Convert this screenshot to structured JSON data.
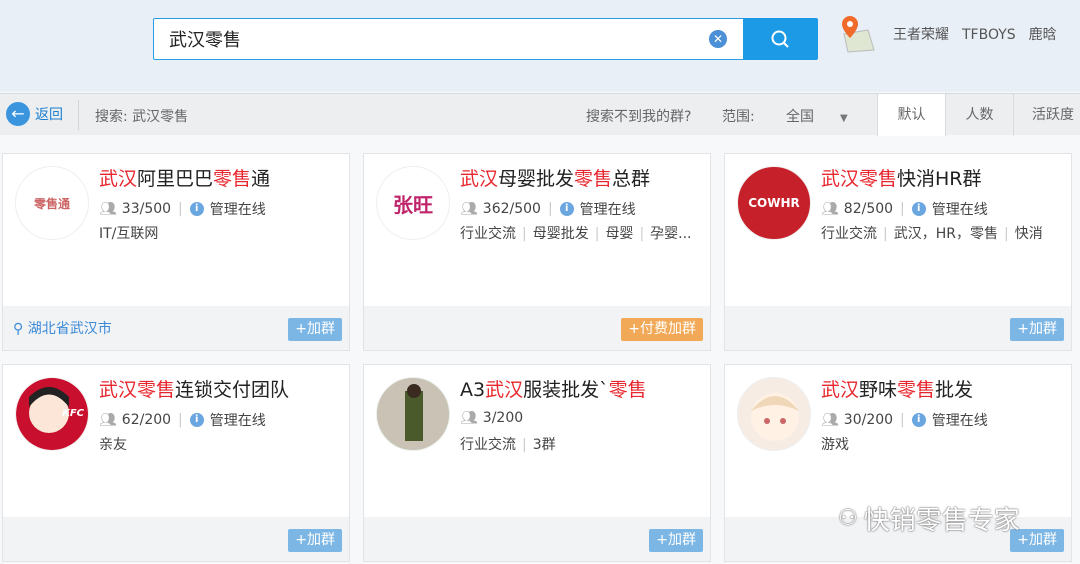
{
  "search": {
    "value": "武汉零售"
  },
  "header_links": [
    "王者荣耀",
    "TFBOYS",
    "鹿晗"
  ],
  "toolbar": {
    "back": "返回",
    "search_text": "搜索: 武汉零售",
    "not_found": "搜索不到我的群?",
    "scope_label": "范围:",
    "scope_value": "全国",
    "sort_tabs": [
      "默认",
      "人数",
      "活跃度"
    ]
  },
  "cards": [
    {
      "title": [
        {
          "t": "武汉",
          "h": true
        },
        {
          "t": "阿里巴巴",
          "h": false
        },
        {
          "t": "零售",
          "h": true
        },
        {
          "t": "通",
          "h": false
        }
      ],
      "members": "33/500",
      "status": "管理在线",
      "tags": [
        "IT/互联网"
      ],
      "location": "湖北省武汉市",
      "join": "+加群",
      "paid": false,
      "avatar_text": "零售通"
    },
    {
      "title": [
        {
          "t": "武汉",
          "h": true
        },
        {
          "t": "母婴批发",
          "h": false
        },
        {
          "t": "零售",
          "h": true
        },
        {
          "t": "总群",
          "h": false
        }
      ],
      "members": "362/500",
      "status": "管理在线",
      "tags": [
        "行业交流",
        "母婴批发",
        "母婴",
        "孕婴..."
      ],
      "join": "+付费加群",
      "paid": true,
      "avatar_text": "张旺"
    },
    {
      "title": [
        {
          "t": "武汉零售",
          "h": true
        },
        {
          "t": "快消HR群",
          "h": false
        }
      ],
      "members": "82/500",
      "status": "管理在线",
      "tags": [
        "行业交流",
        "武汉，HR，零售",
        "快消"
      ],
      "join": "+加群",
      "paid": false,
      "avatar_text": "COWHR"
    },
    {
      "title": [
        {
          "t": "武汉零售",
          "h": true
        },
        {
          "t": "连锁交付团队",
          "h": false
        }
      ],
      "members": "62/200",
      "status": "管理在线",
      "tags": [
        "亲友"
      ],
      "join": "+加群",
      "paid": false,
      "avatar_text": "KFC"
    },
    {
      "title": [
        {
          "t": "A3",
          "h": false
        },
        {
          "t": "武汉",
          "h": true
        },
        {
          "t": "服装批发`",
          "h": false
        },
        {
          "t": "零售",
          "h": true
        }
      ],
      "members": "3/200",
      "status": "",
      "tags": [
        "行业交流",
        "3群"
      ],
      "join": "+加群",
      "paid": false,
      "avatar_text": ""
    },
    {
      "title": [
        {
          "t": "武汉",
          "h": true
        },
        {
          "t": "野味",
          "h": false
        },
        {
          "t": "零售",
          "h": true
        },
        {
          "t": "批发",
          "h": false
        }
      ],
      "members": "30/200",
      "status": "管理在线",
      "tags": [
        "游戏"
      ],
      "join": "+加群",
      "paid": false,
      "avatar_text": ""
    }
  ],
  "watermark": "快销零售专家"
}
